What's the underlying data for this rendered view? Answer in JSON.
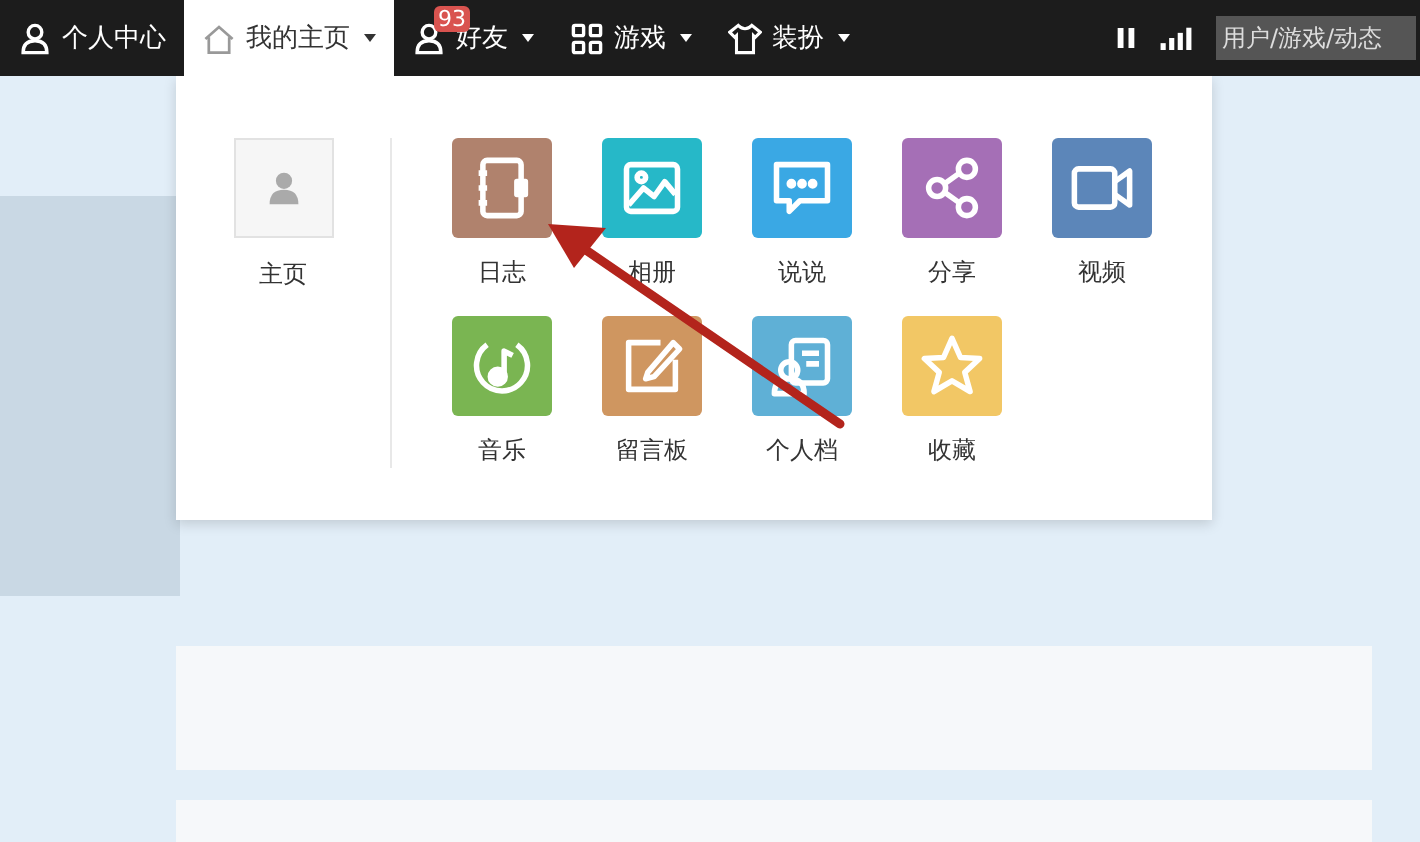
{
  "nav": [
    {
      "kind": "person",
      "label": "个人中心",
      "selected": false,
      "caret": false
    },
    {
      "kind": "home",
      "label": "我的主页",
      "selected": true,
      "caret": true
    },
    {
      "kind": "friends",
      "label": "好友",
      "selected": false,
      "caret": true,
      "badge": "93"
    },
    {
      "kind": "grid",
      "label": "游戏",
      "selected": false,
      "caret": true
    },
    {
      "kind": "shirt",
      "label": "装扮",
      "selected": false,
      "caret": true
    }
  ],
  "search": {
    "placeholder": "用户/游戏/动态"
  },
  "home_link": {
    "label": "主页"
  },
  "apps": [
    {
      "kind": "diary",
      "label": "日志",
      "color": "#b0826d"
    },
    {
      "kind": "photo",
      "label": "相册",
      "color": "#26b8c8"
    },
    {
      "kind": "chat",
      "label": "说说",
      "color": "#3aa8e4"
    },
    {
      "kind": "share",
      "label": "分享",
      "color": "#a56fb6"
    },
    {
      "kind": "video",
      "label": "视频",
      "color": "#5c86b9"
    },
    {
      "kind": "music",
      "label": "音乐",
      "color": "#7ab552"
    },
    {
      "kind": "board",
      "label": "留言板",
      "color": "#cf9660"
    },
    {
      "kind": "profile",
      "label": "个人档",
      "color": "#5fb0d6"
    },
    {
      "kind": "star",
      "label": "收藏",
      "color": "#f2c765"
    }
  ]
}
